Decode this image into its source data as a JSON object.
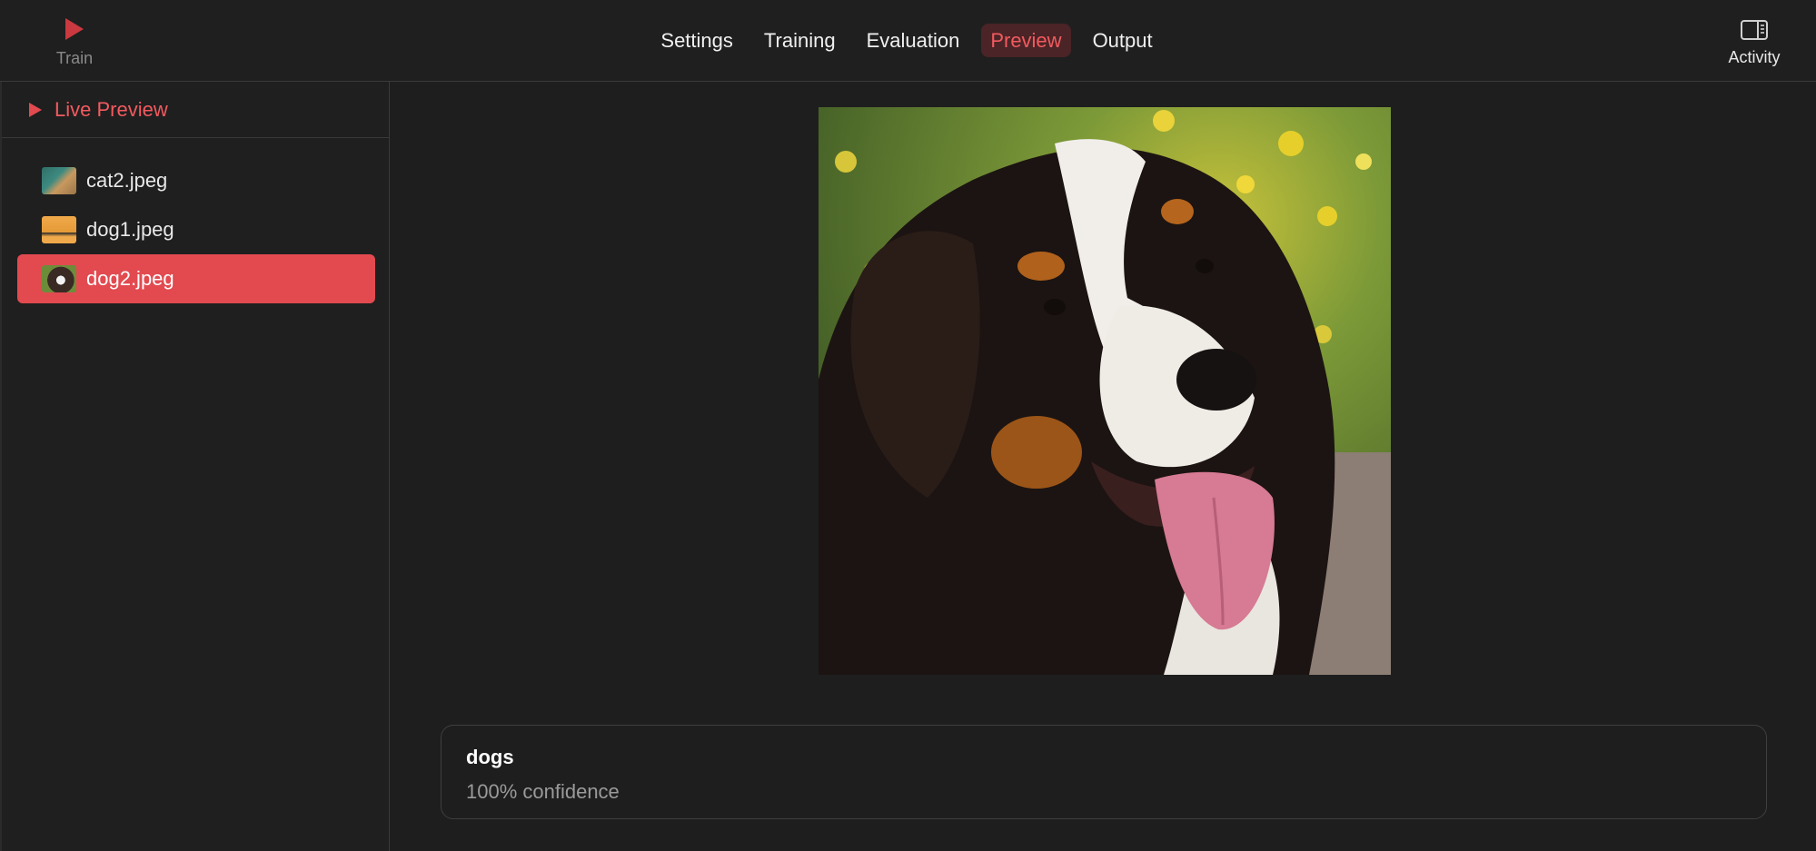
{
  "toolbar": {
    "train_label": "Train",
    "activity_label": "Activity",
    "tabs": [
      {
        "label": "Settings",
        "active": false
      },
      {
        "label": "Training",
        "active": false
      },
      {
        "label": "Evaluation",
        "active": false
      },
      {
        "label": "Preview",
        "active": true
      },
      {
        "label": "Output",
        "active": false
      }
    ]
  },
  "sidebar": {
    "live_preview_label": "Live Preview",
    "files": [
      {
        "name": "cat2.jpeg",
        "thumb": "cat",
        "selected": false
      },
      {
        "name": "dog1.jpeg",
        "thumb": "dog1",
        "selected": false
      },
      {
        "name": "dog2.jpeg",
        "thumb": "dog2",
        "selected": true
      }
    ]
  },
  "main": {
    "image_subject": "bernese-mountain-dog-photo",
    "result": {
      "label": "dogs",
      "confidence": "100% confidence"
    }
  },
  "colors": {
    "accent": "#e24a50",
    "accent_text": "#f25a5f",
    "background": "#1e1e1e"
  }
}
